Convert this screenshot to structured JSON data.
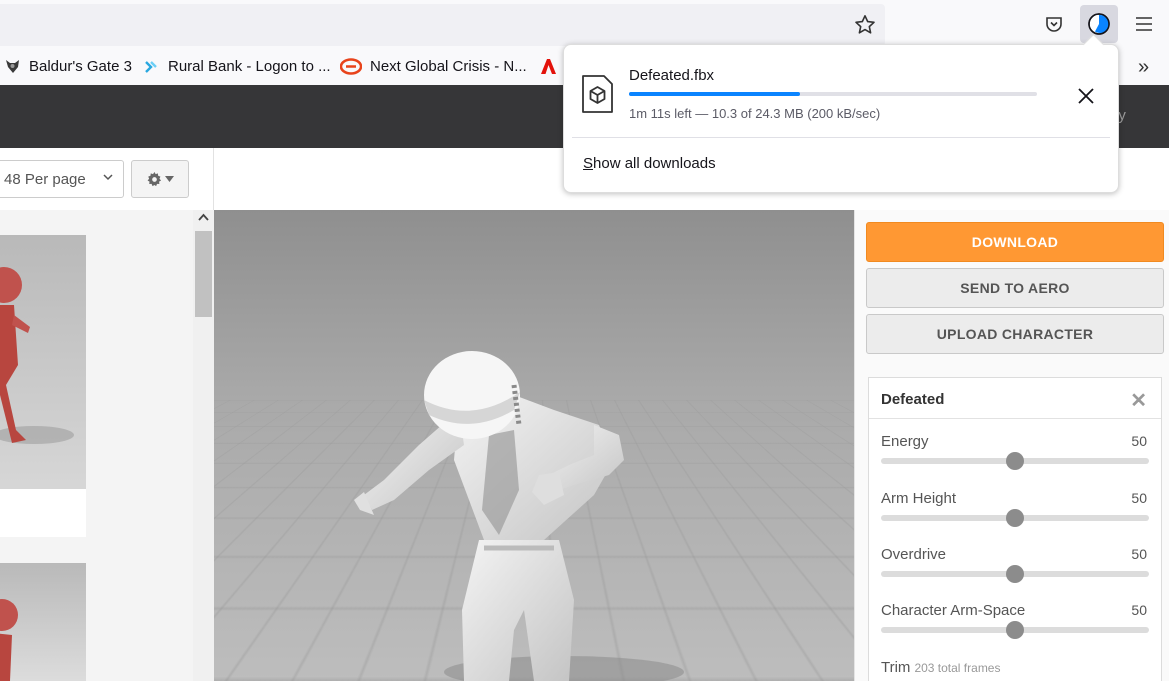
{
  "browser": {
    "bookmarks": [
      {
        "label": "Baldur's Gate 3",
        "icon": "baldurs-gate-favicon"
      },
      {
        "label": "Rural Bank - Logon to ...",
        "icon": "rural-bank-favicon"
      },
      {
        "label": "Next Global Crisis - N...",
        "icon": "next-global-crisis-favicon"
      }
    ],
    "overflow_label": "»"
  },
  "downloads_popup": {
    "file_name": "Defeated.fbx",
    "progress": 0.42,
    "status": "1m 11s left — 10.3 of 24.3 MB (200 kB/sec)",
    "show_all_first": "S",
    "show_all_rest": "how all downloads"
  },
  "site_header": {
    "peek_text": "ay"
  },
  "controls": {
    "per_page": "48 Per page"
  },
  "panel": {
    "download_label": "DOWNLOAD",
    "send_label": "SEND TO AERO",
    "upload_label": "UPLOAD CHARACTER",
    "card_title": "Defeated",
    "sliders": [
      {
        "label": "Energy",
        "value": "50",
        "level": 0.5
      },
      {
        "label": "Arm Height",
        "value": "50",
        "level": 0.5
      },
      {
        "label": "Overdrive",
        "value": "50",
        "level": 0.5
      },
      {
        "label": "Character Arm-Space",
        "value": "50",
        "level": 0.5
      }
    ],
    "trim_label": "Trim",
    "trim_frames": "203 total frames"
  },
  "colors": {
    "accent": "#ff9833",
    "progress": "#0a84ff",
    "header": "#363638"
  }
}
